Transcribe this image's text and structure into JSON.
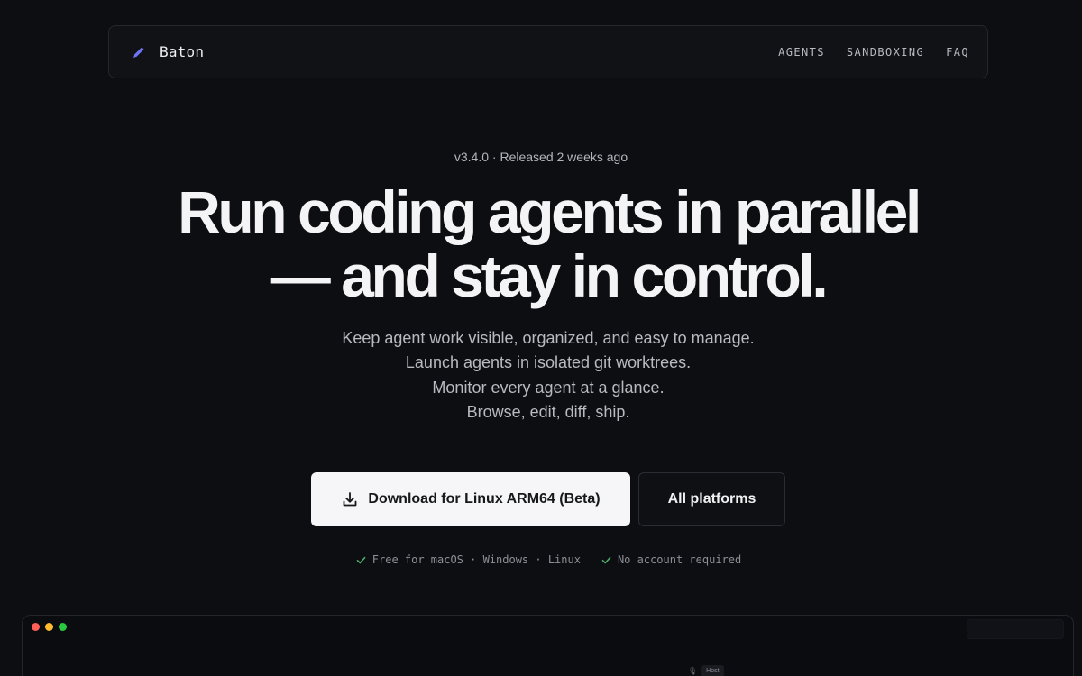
{
  "nav": {
    "brand": "Baton",
    "brand_icon": "pencil-icon",
    "brand_color": "#6f74f5",
    "links": [
      "AGENTS",
      "SANDBOXING",
      "FAQ"
    ]
  },
  "hero": {
    "release": "v3.4.0 · Released 2 weeks ago",
    "headline": [
      "Run coding agents in parallel",
      "— and stay in control."
    ],
    "tagline": [
      "Keep agent work visible, organized, and easy to manage.",
      "Launch agents in isolated git worktrees.",
      "Monitor every agent at a glance.",
      "Browse, edit, diff, ship."
    ]
  },
  "cta": {
    "primary": "Download for Linux ARM64 (Beta)",
    "primary_icon": "download-icon",
    "secondary": "All platforms"
  },
  "checks": {
    "icon": "check-icon",
    "color": "#4caf6a",
    "items": [
      "Free for macOS · Windows · Linux",
      "No account required"
    ]
  },
  "preview": {
    "host_label": "Host"
  }
}
